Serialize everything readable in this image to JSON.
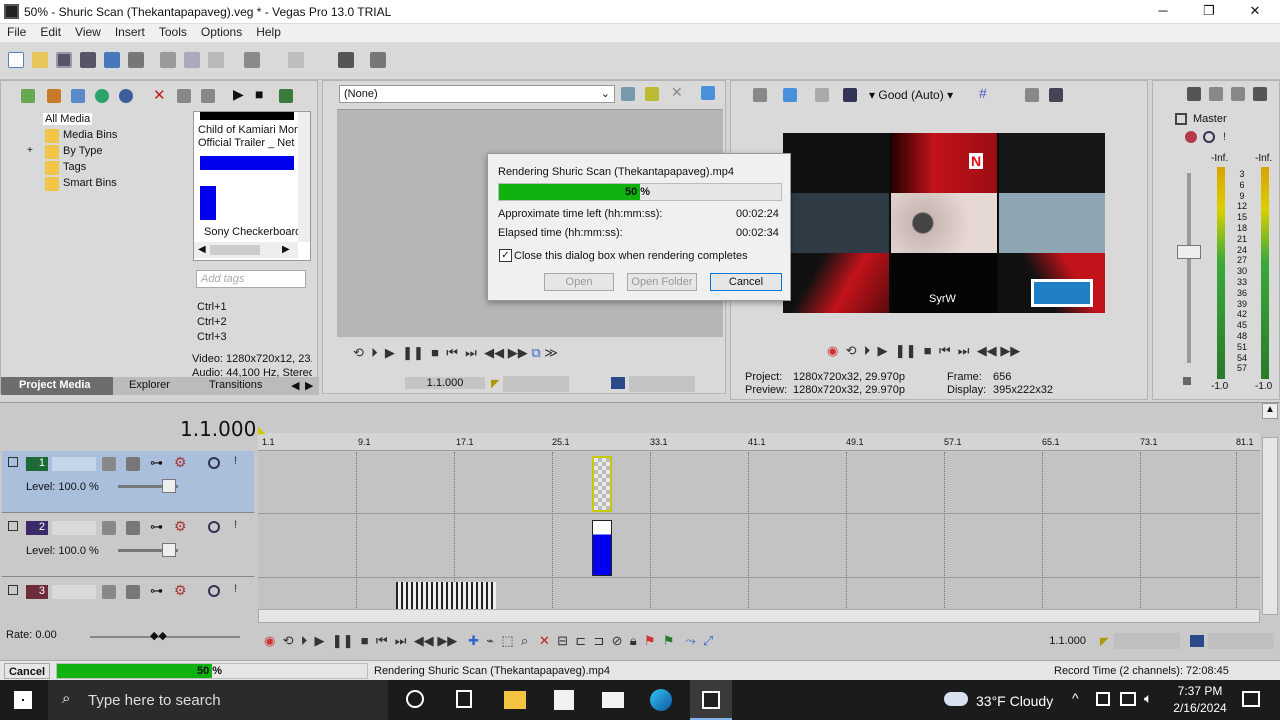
{
  "window": {
    "title": "50% - Shuric Scan (Thekantapapaveg).veg * - Vegas Pro 13.0 TRIAL",
    "minimize": "─",
    "maximize": "❐",
    "close": "✕"
  },
  "menu": [
    "File",
    "Edit",
    "View",
    "Insert",
    "Tools",
    "Options",
    "Help"
  ],
  "explorer": {
    "tree": [
      "All Media",
      "Media Bins",
      "By Type",
      "Tags",
      "Smart Bins"
    ],
    "expander": "+",
    "thumb1_line1": "Child of Kamiari Mon",
    "thumb1_line2": "Official Trailer _ Net",
    "thumb2_label": "Sony Checkerboard",
    "tags_placeholder": "Add tags",
    "shortcuts": [
      "Ctrl+1",
      "Ctrl+2",
      "Ctrl+3"
    ],
    "video_info": "Video: 1280x720x12, 23.",
    "audio_info": "Audio: 44,100 Hz, Stereo"
  },
  "left_tabs": [
    "Project Media",
    "Explorer",
    "Transitions"
  ],
  "trimmer": {
    "dropdown": "(None)",
    "timecode": "1.1.000"
  },
  "preview": {
    "quality": "Good (Auto)",
    "project_label": "Project:",
    "project_val": "1280x720x32, 29.970p",
    "preview_label": "Preview:",
    "preview_val": "1280x720x32, 29.970p",
    "frame_label": "Frame:",
    "frame_val": "656",
    "display_label": "Display:",
    "display_val": "395x222x32",
    "netflix": "N",
    "text_overlay": "SyrW"
  },
  "master": {
    "title": "Master",
    "inf_left": "-Inf.",
    "inf_right": "-Inf.",
    "scale": [
      "3",
      "6",
      "9",
      "12",
      "15",
      "18",
      "21",
      "24",
      "27",
      "30",
      "33",
      "36",
      "39",
      "42",
      "45",
      "48",
      "51",
      "54",
      "57"
    ],
    "bottom_left": "-1.0",
    "bottom_right": "-1.0"
  },
  "dialog": {
    "title": "Rendering Shuric Scan (Thekantapapaveg).mp4",
    "progress_text": "50 %",
    "progress": 0.5,
    "approx_label": "Approximate time left (hh:mm:ss):",
    "approx_val": "00:02:24",
    "elapsed_label": "Elapsed time (hh:mm:ss):",
    "elapsed_val": "00:02:34",
    "checkbox_label": "Close this dialog box when rendering completes",
    "open": "Open",
    "open_folder": "Open Folder",
    "cancel": "Cancel"
  },
  "timeline": {
    "cursor_time": "1.1.000",
    "ruler": [
      "1.1",
      "9.1",
      "17.1",
      "25.1",
      "33.1",
      "41.1",
      "49.1",
      "57.1",
      "65.1",
      "73.1",
      "81.1"
    ],
    "tracks": [
      {
        "num": "1",
        "level": "Level: 100.0 %"
      },
      {
        "num": "2",
        "level": "Level: 100.0 %"
      },
      {
        "num": "3",
        "level": ""
      }
    ],
    "rate": "Rate: 0.00",
    "transport_time": "1.1.000"
  },
  "statusbar": {
    "cancel": "Cancel",
    "progress_text": "50 %",
    "progress": 0.5,
    "render_text": "Rendering Shuric Scan (Thekantapapaveg).mp4",
    "record_time": "Record Time (2 channels): 72:08:45"
  },
  "taskbar": {
    "search": "Type here to search",
    "weather": "33°F  Cloudy",
    "time": "7:37 PM",
    "date": "2/16/2024"
  }
}
